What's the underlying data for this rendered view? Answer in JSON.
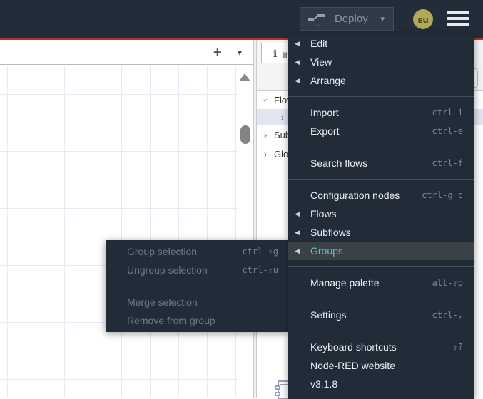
{
  "header": {
    "deploy_label": "Deploy",
    "avatar_text": "su"
  },
  "icons": {
    "submenu_arrow": "◀",
    "deploy_caret": "▾",
    "add_flow": "+",
    "flow_list_caret": "▾",
    "info_tab": "i",
    "chevron": "›"
  },
  "colors": {
    "header_bg": "#232d3a",
    "accent_red": "#c22d30",
    "menu_bg": "#222c39",
    "menu_highlight_bg": "#3c4147",
    "menu_highlight_text": "#5ac1bf",
    "avatar_bg": "#b2a956",
    "selected_row_bg": "#e3e5f2",
    "grid_line": "#e9e9f4"
  },
  "sidebar": {
    "tab_label": "info",
    "tree": {
      "rows": [
        {
          "label": "Flows"
        },
        {
          "label": ""
        },
        {
          "label": "Subflows"
        },
        {
          "label": "Global Configuration Nodes"
        }
      ]
    }
  },
  "main_menu": {
    "items": [
      {
        "label": "Edit",
        "has_submenu": true
      },
      {
        "label": "View",
        "has_submenu": true
      },
      {
        "label": "Arrange",
        "has_submenu": true
      },
      {
        "separator": true
      },
      {
        "label": "Import",
        "shortcut": "ctrl-i"
      },
      {
        "label": "Export",
        "shortcut": "ctrl-e"
      },
      {
        "separator": true
      },
      {
        "label": "Search flows",
        "shortcut": "ctrl-f"
      },
      {
        "separator": true
      },
      {
        "label": "Configuration nodes",
        "shortcut": "ctrl-g c"
      },
      {
        "label": "Flows",
        "has_submenu": true
      },
      {
        "label": "Subflows",
        "has_submenu": true
      },
      {
        "label": "Groups",
        "has_submenu": true,
        "highlighted": true
      },
      {
        "separator": true
      },
      {
        "label": "Manage palette",
        "shortcut": "alt-⇧p"
      },
      {
        "separator": true
      },
      {
        "label": "Settings",
        "shortcut": "ctrl-,"
      },
      {
        "separator": true
      },
      {
        "label": "Keyboard shortcuts",
        "shortcut": "⇧?"
      },
      {
        "label": "Node-RED website"
      },
      {
        "label": "v3.1.8"
      }
    ]
  },
  "group_submenu": {
    "items": [
      {
        "label": "Group selection",
        "shortcut": "ctrl-⇧g",
        "disabled": true
      },
      {
        "label": "Ungroup selection",
        "shortcut": "ctrl-⇧u",
        "disabled": true
      },
      {
        "separator": true
      },
      {
        "label": "Merge selection",
        "disabled": true
      },
      {
        "label": "Remove from group",
        "disabled": true
      }
    ]
  }
}
